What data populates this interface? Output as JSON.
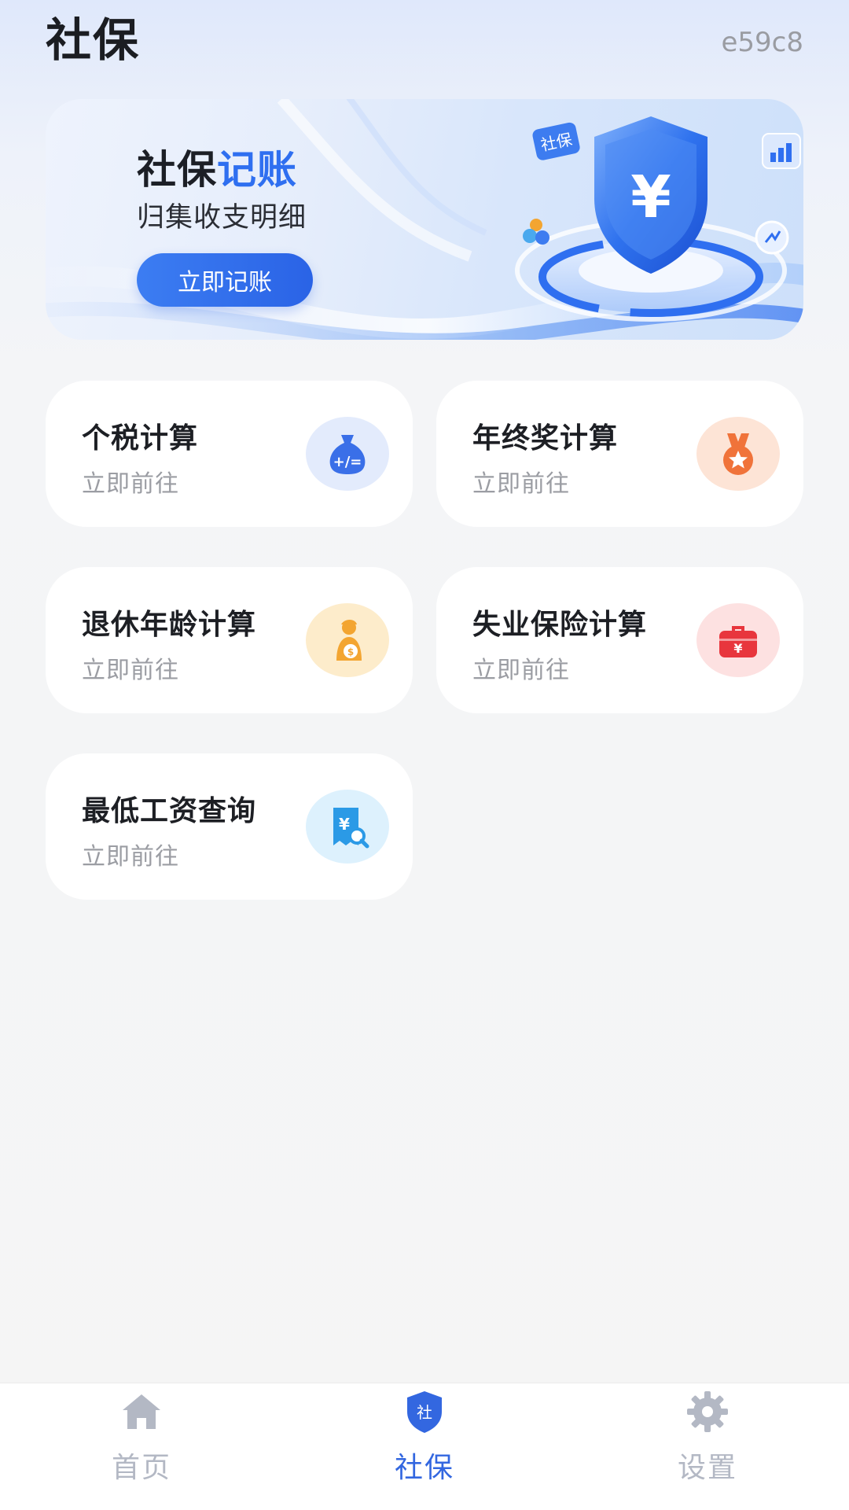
{
  "header": {
    "title": "社保",
    "code": "e59c8"
  },
  "banner": {
    "title_part1": "社保",
    "title_part2": "记账",
    "subtitle": "归集收支明细",
    "button_label": "立即记账",
    "art_tag": "社保",
    "art_symbol": "¥"
  },
  "cards": [
    {
      "title": "个税计算",
      "subtitle": "立即前往",
      "icon": "tax-money-bag-icon"
    },
    {
      "title": "年终奖计算",
      "subtitle": "立即前往",
      "icon": "medal-icon"
    },
    {
      "title": "退休年龄计算",
      "subtitle": "立即前往",
      "icon": "retiree-icon"
    },
    {
      "title": "失业保险计算",
      "subtitle": "立即前往",
      "icon": "briefcase-icon"
    },
    {
      "title": "最低工资查询",
      "subtitle": "立即前往",
      "icon": "wage-search-icon"
    }
  ],
  "tabbar": {
    "items": [
      {
        "label": "首页",
        "icon": "home-icon",
        "active": false
      },
      {
        "label": "社保",
        "icon": "shield-icon",
        "active": true,
        "badge": "社"
      },
      {
        "label": "设置",
        "icon": "gear-icon",
        "active": false
      }
    ]
  },
  "colors": {
    "accent": "#2f6ff0",
    "tab_inactive": "#b3b8c4",
    "tab_active": "#3367e0"
  }
}
